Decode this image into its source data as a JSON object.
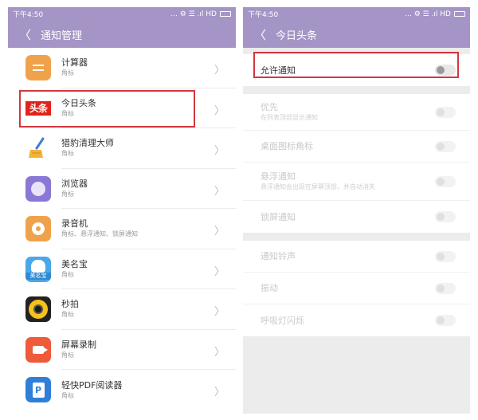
{
  "left": {
    "status": {
      "time": "下午4:50",
      "icons": "... ⚙ ☰ .ıl HD"
    },
    "title": "通知管理",
    "back_glyph": "〈",
    "chevron_glyph": "〉",
    "apps": [
      {
        "name": "计算器",
        "sub": "角标",
        "icon": "calculator-icon"
      },
      {
        "name": "今日头条",
        "sub": "角标",
        "icon": "toutiao-icon",
        "icon_text": "头条"
      },
      {
        "name": "猎豹清理大师",
        "sub": "角标",
        "icon": "broom-icon"
      },
      {
        "name": "浏览器",
        "sub": "角标",
        "icon": "browser-icon"
      },
      {
        "name": "录音机",
        "sub": "角标、悬浮通知、锁屏通知",
        "icon": "recorder-icon"
      },
      {
        "name": "美名宝",
        "sub": "角标",
        "icon": "meimingbao-icon",
        "icon_text": "美名宝"
      },
      {
        "name": "秒拍",
        "sub": "角标",
        "icon": "miaopai-icon"
      },
      {
        "name": "屏幕录制",
        "sub": "角标",
        "icon": "screen-record-icon"
      },
      {
        "name": "轻快PDF阅读器",
        "sub": "角标",
        "icon": "pdf-reader-icon",
        "icon_text": "P"
      }
    ],
    "highlighted_index": 1
  },
  "right": {
    "status": {
      "time": "下午4:50",
      "icons": "... ⚙ ☰ .ıl HD"
    },
    "title": "今日头条",
    "back_glyph": "〈",
    "allow": {
      "label": "允许通知",
      "on": false
    },
    "group1": [
      {
        "label": "优先",
        "sub": "在列表顶部显示通知"
      },
      {
        "label": "桌面图标角标",
        "sub": ""
      },
      {
        "label": "悬浮通知",
        "sub": "悬浮通知会出现在屏幕顶部，并自动消失"
      },
      {
        "label": "锁屏通知",
        "sub": ""
      }
    ],
    "group2": [
      {
        "label": "通知铃声",
        "sub": ""
      },
      {
        "label": "振动",
        "sub": ""
      },
      {
        "label": "呼吸灯闪烁",
        "sub": ""
      }
    ]
  },
  "colors": {
    "header": "#a495c6",
    "highlight": "#d3373f"
  }
}
